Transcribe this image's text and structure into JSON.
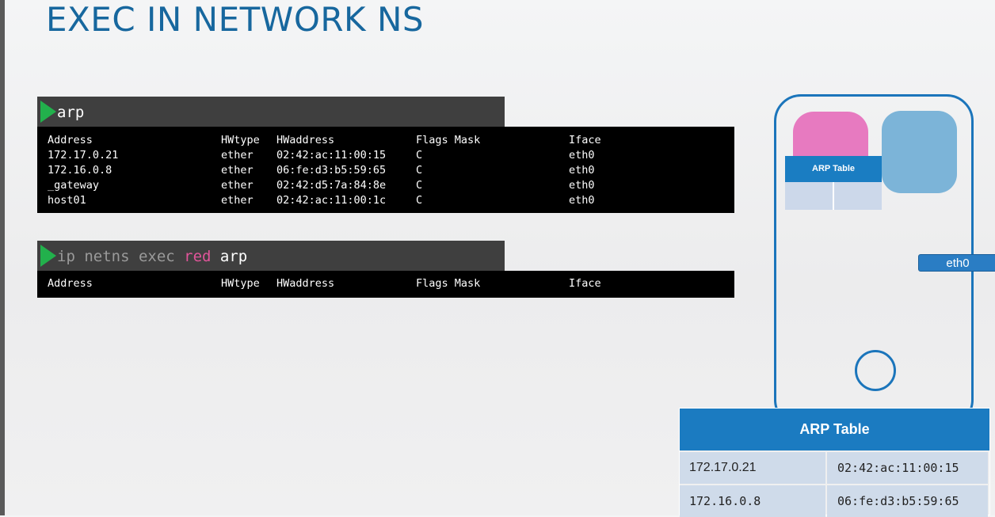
{
  "title": "EXEC IN NETWORK NS",
  "terminal1": {
    "command": "arp",
    "header": [
      "Address",
      "HWtype",
      "HWaddress",
      "Flags Mask",
      "Iface"
    ],
    "rows": [
      [
        "172.17.0.21",
        "ether",
        "02:42:ac:11:00:15",
        "C",
        "eth0"
      ],
      [
        "172.16.0.8",
        "ether",
        "06:fe:d3:b5:59:65",
        "C",
        "eth0"
      ],
      [
        "_gateway",
        "ether",
        "02:42:d5:7a:84:8e",
        "C",
        "eth0"
      ],
      [
        "host01",
        "ether",
        "02:42:ac:11:00:1c",
        "C",
        "eth0"
      ]
    ]
  },
  "terminal2": {
    "command_prefix": "ip netns exec ",
    "command_ns": "red",
    "command_suffix": " arp",
    "header": [
      "Address",
      "HWtype",
      "HWaddress",
      "Flags Mask",
      "Iface"
    ]
  },
  "diagram": {
    "mini_table_label": "ARP Table",
    "interface_label": "eth0",
    "colors": {
      "host_border": "#1b75bb",
      "namespace_pink": "#e77ac0",
      "namespace_blue": "#7cb4d8",
      "table_header": "#1b7bc1"
    }
  },
  "arp_table": {
    "title": "ARP Table",
    "rows": [
      [
        "172.17.0.21",
        "02:42:ac:11:00:15"
      ],
      [
        "172.16.0.8",
        "06:fe:d3:b5:59:65"
      ]
    ]
  }
}
